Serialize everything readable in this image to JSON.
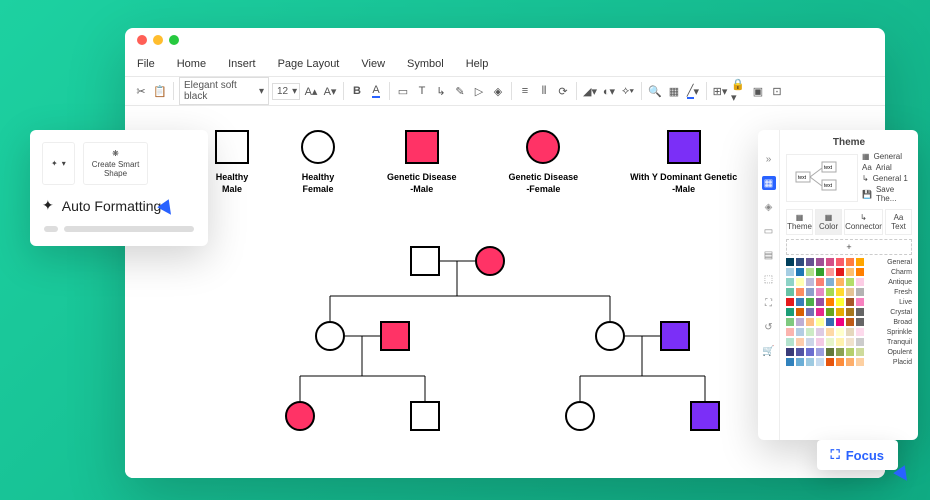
{
  "menu": {
    "file": "File",
    "home": "Home",
    "insert": "Insert",
    "pageLayout": "Page Layout",
    "view": "View",
    "symbol": "Symbol",
    "help": "Help"
  },
  "toolbar": {
    "font": "Elegant soft black",
    "fontSize": "12"
  },
  "legend": {
    "healthyMale": "Healthy\nMale",
    "healthyFemale": "Healthy\nFemale",
    "geneticMale": "Genetic Disease\n-Male",
    "geneticFemale": "Genetic Disease\n-Female",
    "yDominant": "With Y Dominant Genetic\n-Male"
  },
  "popup": {
    "createSmart": "Create Smart\nShape",
    "autoFormat": "Auto Formatting"
  },
  "themePanel": {
    "title": "Theme",
    "sideList": {
      "general": "General",
      "arial": "Arial",
      "general1": "General 1",
      "saveThe": "Save The..."
    },
    "tabs": {
      "theme": "Theme",
      "color": "Color",
      "connector": "Connector",
      "text": "Text"
    },
    "previewTexts": {
      "t1": "text",
      "t2": "text",
      "t3": "text"
    },
    "colorSets": [
      "General",
      "Charm",
      "Antique",
      "Fresh",
      "Live",
      "Crystal",
      "Broad",
      "Sprinkle",
      "Tranquil",
      "Opulent",
      "Placid"
    ]
  },
  "focus": {
    "label": "Focus"
  },
  "colors": {
    "red": "#ff3366",
    "purple": "#7b2ff7",
    "blue": "#2962ff",
    "palette": [
      [
        "#003f5c",
        "#2f4b7c",
        "#665191",
        "#a05195",
        "#d45087",
        "#f95d6a",
        "#ff7c43",
        "#ffa600"
      ],
      [
        "#a6cee3",
        "#1f78b4",
        "#b2df8a",
        "#33a02c",
        "#fb9a99",
        "#e31a1c",
        "#fdbf6f",
        "#ff7f00"
      ],
      [
        "#8dd3c7",
        "#ffffb3",
        "#bebada",
        "#fb8072",
        "#80b1d3",
        "#fdb462",
        "#b3de69",
        "#fccde5"
      ],
      [
        "#66c2a5",
        "#fc8d62",
        "#8da0cb",
        "#e78ac3",
        "#a6d854",
        "#ffd92f",
        "#e5c494",
        "#b3b3b3"
      ],
      [
        "#e41a1c",
        "#377eb8",
        "#4daf4a",
        "#984ea3",
        "#ff7f00",
        "#ffff33",
        "#a65628",
        "#f781bf"
      ],
      [
        "#1b9e77",
        "#d95f02",
        "#7570b3",
        "#e7298a",
        "#66a61e",
        "#e6ab02",
        "#a6761d",
        "#666666"
      ],
      [
        "#7fc97f",
        "#beaed4",
        "#fdc086",
        "#ffff99",
        "#386cb0",
        "#f0027f",
        "#bf5b17",
        "#666666"
      ],
      [
        "#fbb4ae",
        "#b3cde3",
        "#ccebc5",
        "#decbe4",
        "#fed9a6",
        "#ffffcc",
        "#e5d8bd",
        "#fddaec"
      ],
      [
        "#b3e2cd",
        "#fdcdac",
        "#cbd5e8",
        "#f4cae4",
        "#e6f5c9",
        "#fff2ae",
        "#f1e2cc",
        "#cccccc"
      ],
      [
        "#393b79",
        "#5254a3",
        "#6b6ecf",
        "#9c9ede",
        "#637939",
        "#8ca252",
        "#b5cf6b",
        "#cedb9c"
      ],
      [
        "#3182bd",
        "#6baed6",
        "#9ecae1",
        "#c6dbef",
        "#e6550d",
        "#fd8d3c",
        "#fdae6b",
        "#fdd0a2"
      ]
    ]
  }
}
